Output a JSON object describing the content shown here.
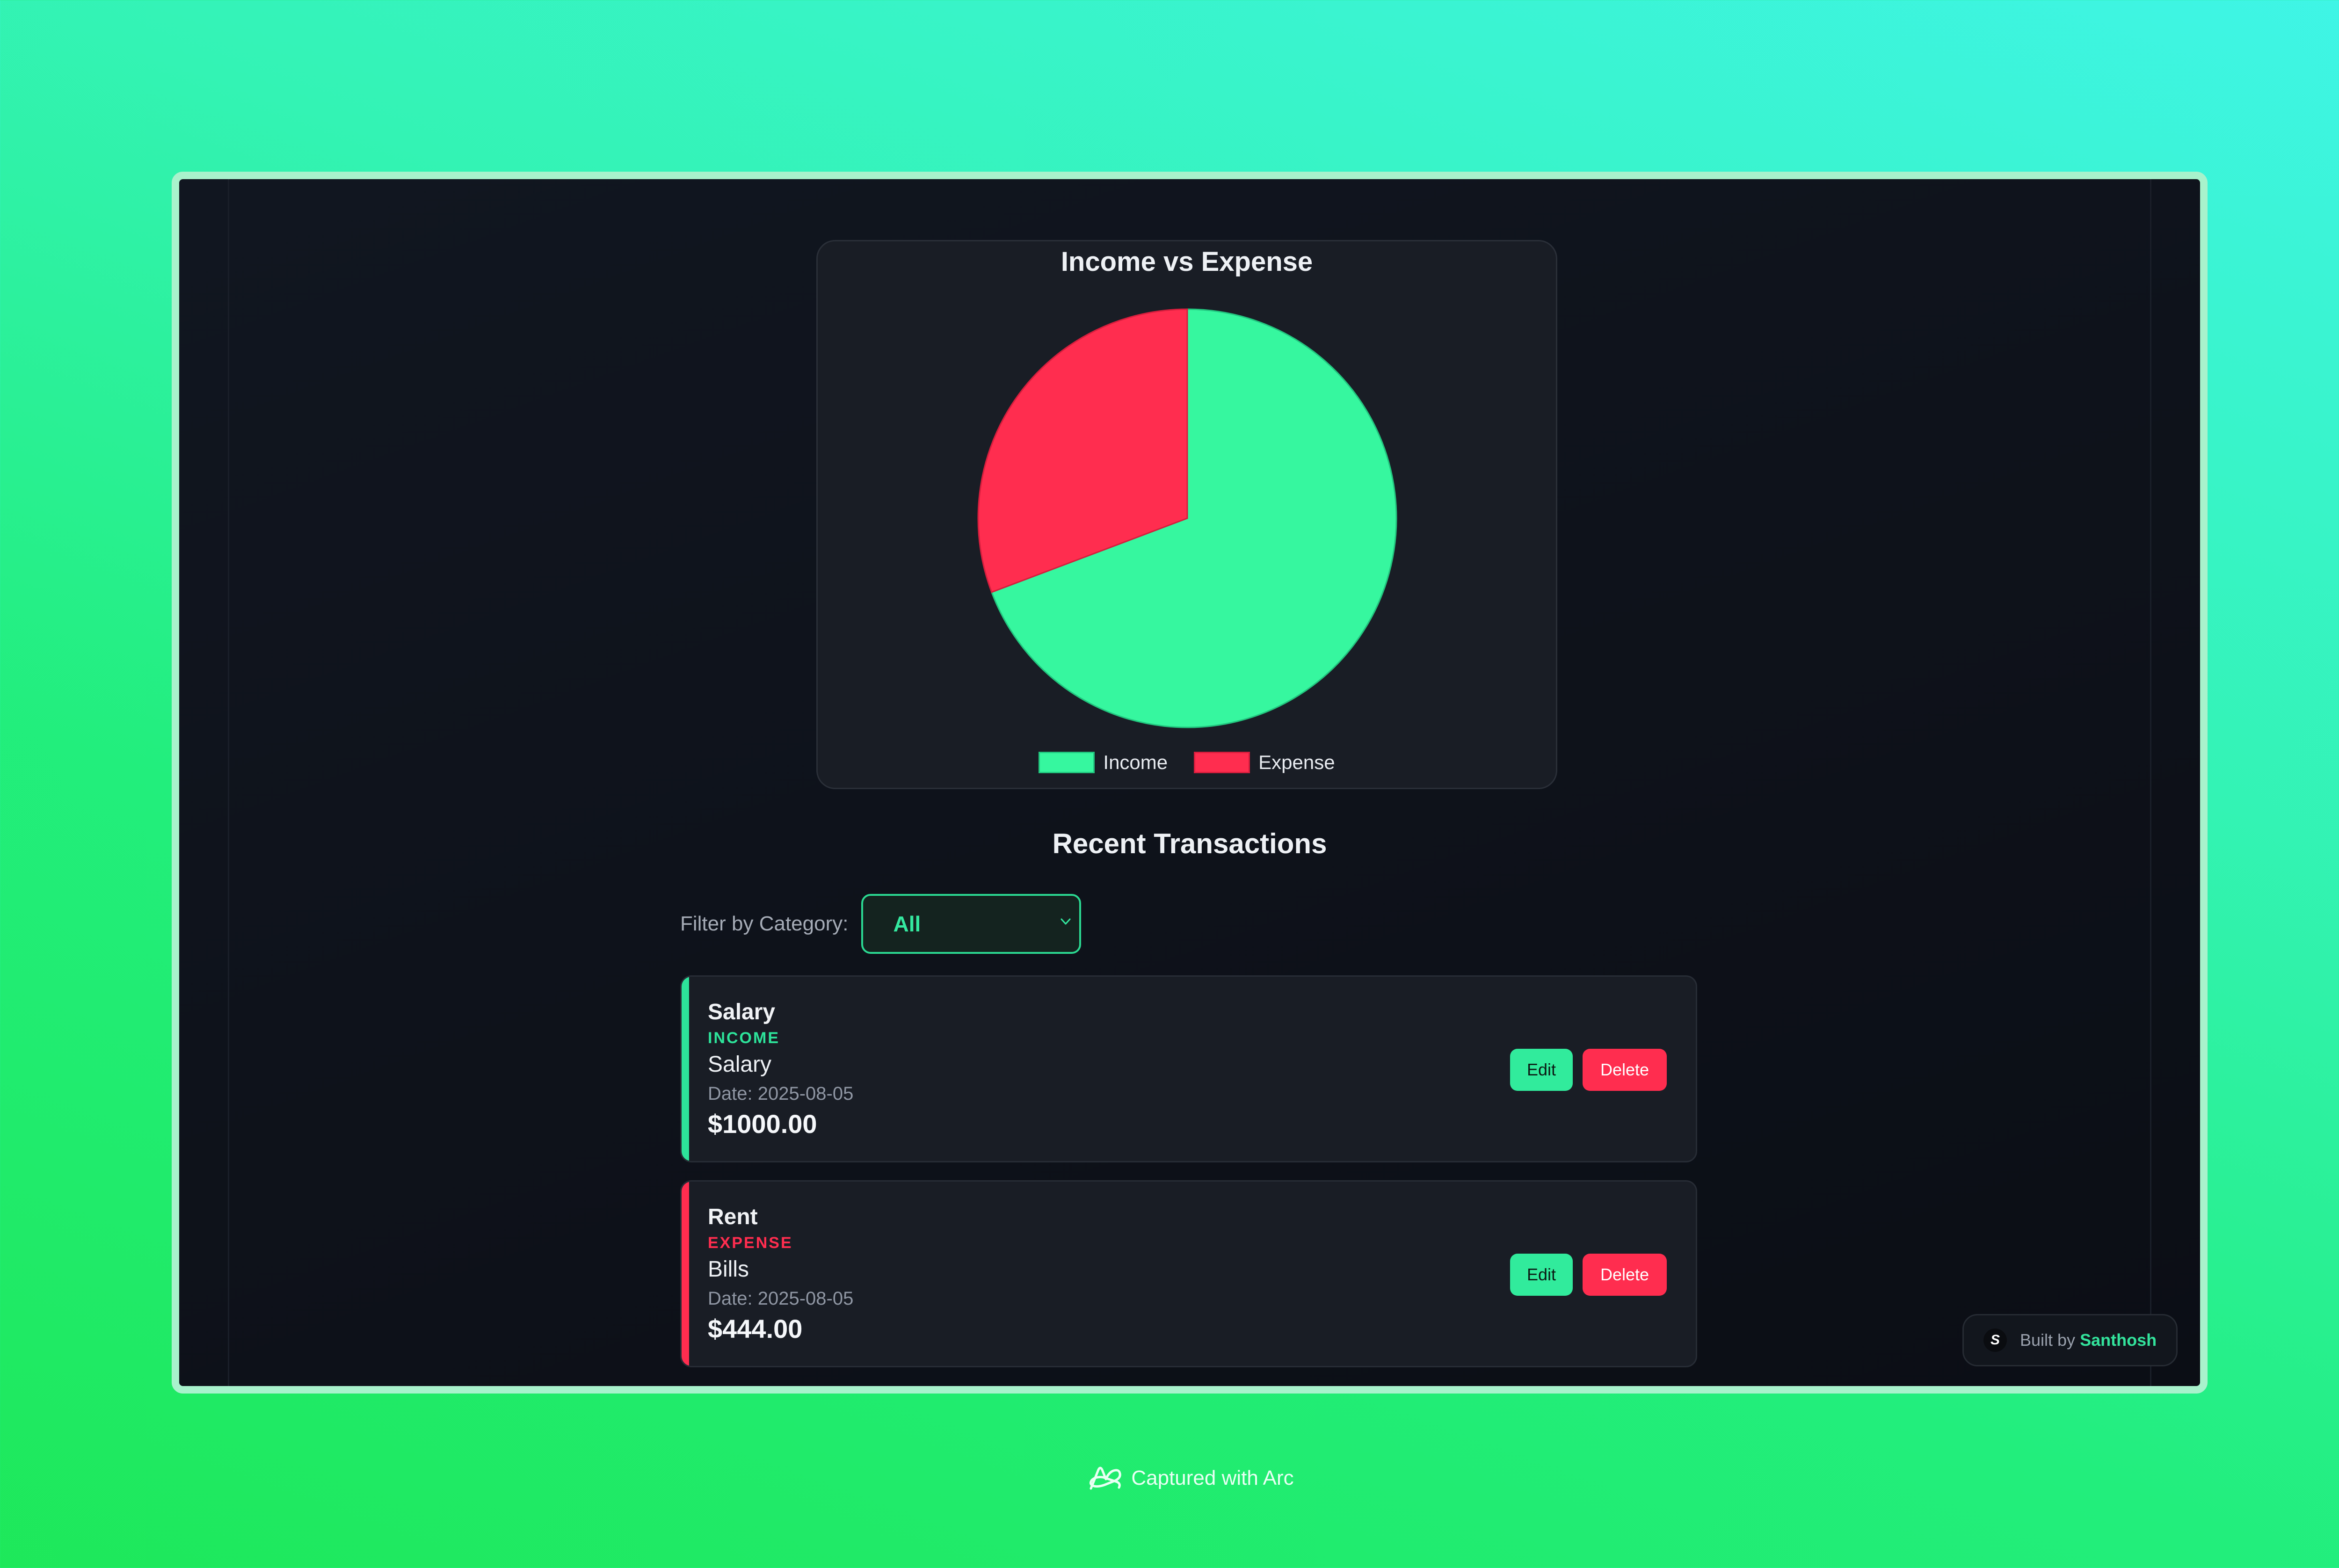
{
  "chart_data": {
    "type": "pie",
    "title": "Income vs Expense",
    "categories": [
      "Income",
      "Expense"
    ],
    "values": [
      1000,
      444
    ],
    "colors": [
      "#36f79f",
      "#ff2d4f"
    ],
    "legend_position": "bottom"
  },
  "transactions_section": {
    "title": "Recent Transactions",
    "filter_label": "Filter by Category:",
    "filter_value": "All"
  },
  "transactions": [
    {
      "name": "Salary",
      "type": "INCOME",
      "category": "Salary",
      "date": "Date: 2025-08-05",
      "amount": "$1000.00",
      "accent_color": "#2de39a",
      "edit_label": "Edit",
      "delete_label": "Delete"
    },
    {
      "name": "Rent",
      "type": "EXPENSE",
      "category": "Bills",
      "date": "Date: 2025-08-05",
      "amount": "$444.00",
      "accent_color": "#ff2d4f",
      "edit_label": "Edit",
      "delete_label": "Delete"
    }
  ],
  "badge": {
    "prefix": "Built by",
    "author": "Santhosh",
    "logo_text": "S"
  },
  "footer": {
    "captured_text": "Captured with Arc"
  },
  "colors": {
    "income": "#36f79f",
    "expense": "#ff2d4f",
    "edit_button": "#31eb9c",
    "delete_button": "#ff2d4f",
    "card_background": "#191d25",
    "page_background": "#0d1118"
  },
  "icons": {
    "select_chevron": "chevron-down-icon",
    "badge_logo": "author-logo-icon",
    "arc_logo": "arc-logo-icon"
  }
}
